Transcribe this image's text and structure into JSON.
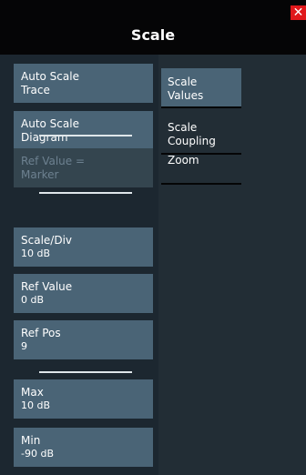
{
  "dialog": {
    "title": "Scale",
    "close_label": "✕"
  },
  "left_buttons": {
    "auto_scale_trace": {
      "line1": "Auto Scale",
      "line2": "Trace"
    },
    "auto_scale_diagram": {
      "line1": "Auto Scale",
      "line2": "Diagram"
    },
    "ref_value_marker": {
      "line1": "Ref Value =",
      "line2": "Marker",
      "disabled": true
    },
    "scale_div": {
      "label": "Scale/Div",
      "value": "10 dB"
    },
    "ref_value": {
      "label": "Ref Value",
      "value": "0 dB"
    },
    "ref_pos": {
      "label": "Ref Pos",
      "value": "9"
    },
    "max": {
      "label": "Max",
      "value": "10 dB"
    },
    "min": {
      "label": "Min",
      "value": "-90 dB"
    }
  },
  "tabs": [
    {
      "line1": "Scale",
      "line2": "Values",
      "active": true
    },
    {
      "line1": "Scale",
      "line2": "Coupling",
      "active": false
    },
    {
      "line1": "Zoom",
      "line2": "",
      "active": false
    }
  ],
  "colors": {
    "titlebar": "#050506",
    "button": "#4a6476",
    "button_disabled": "#34454f",
    "close": "#e0181b"
  }
}
